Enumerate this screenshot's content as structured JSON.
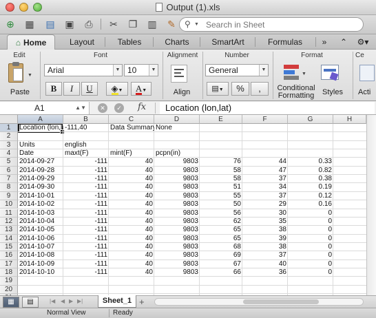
{
  "window": {
    "title": "Output (1).xls"
  },
  "toolbar": {
    "buttons": [
      {
        "icon": "new-document-icon",
        "glyph": "⊕"
      },
      {
        "icon": "templates-icon",
        "glyph": "▦"
      },
      {
        "icon": "open-icon",
        "glyph": "⎙"
      },
      {
        "icon": "save-icon",
        "glyph": "▣"
      },
      {
        "icon": "print-icon",
        "glyph": "⎙"
      },
      {
        "icon": "cut-icon",
        "glyph": "✂"
      },
      {
        "icon": "copy-icon",
        "glyph": "❐"
      },
      {
        "icon": "paste-icon",
        "glyph": "📋"
      },
      {
        "icon": "format-painter-icon",
        "glyph": "🖌"
      }
    ],
    "search_placeholder": "Search in Sheet"
  },
  "ribbon_tabs": [
    "Home",
    "Layout",
    "Tables",
    "Charts",
    "SmartArt",
    "Formulas"
  ],
  "ribbon": {
    "groups": {
      "edit": "Edit",
      "font": "Font",
      "alignment": "Alignment",
      "number": "Number",
      "format": "Format",
      "cells": "Ce"
    },
    "paste_label": "Paste",
    "font_name": "Arial",
    "font_size": "10",
    "bold": "B",
    "italic": "I",
    "underline": "U",
    "align_label": "Align",
    "number_format": "General",
    "percent": "%",
    "comma": ",",
    "conditional_label_1": "Conditional",
    "conditional_label_2": "Formatting",
    "styles_label": "Styles",
    "actions_label": "Acti"
  },
  "formula_bar": {
    "cell_ref": "A1",
    "fx": "fx",
    "content": "Location (lon,lat)"
  },
  "sheet": {
    "columns": [
      "A",
      "B",
      "C",
      "D",
      "E",
      "F",
      "G",
      "H"
    ],
    "row_numbers": [
      "1",
      "2",
      "3",
      "4",
      "5",
      "6",
      "7",
      "8",
      "9",
      "10",
      "11",
      "12",
      "13",
      "14",
      "15",
      "16",
      "17",
      "18",
      "19",
      "20",
      "21"
    ],
    "rows": [
      [
        "Location (lon,lat)",
        "-111,40",
        "Data Summary",
        "None",
        "",
        "",
        "",
        ""
      ],
      [
        "",
        "",
        "",
        "",
        "",
        "",
        "",
        ""
      ],
      [
        "Units",
        "english",
        "",
        "",
        "",
        "",
        "",
        ""
      ],
      [
        "Date",
        "maxt(F)",
        "mint(F)",
        "pcpn(in)",
        "",
        "",
        "",
        ""
      ],
      [
        "2014-09-27",
        "-111",
        "40",
        "9803",
        "76",
        "44",
        "0.33",
        ""
      ],
      [
        "2014-09-28",
        "-111",
        "40",
        "9803",
        "58",
        "47",
        "0.82",
        ""
      ],
      [
        "2014-09-29",
        "-111",
        "40",
        "9803",
        "58",
        "37",
        "0.38",
        ""
      ],
      [
        "2014-09-30",
        "-111",
        "40",
        "9803",
        "51",
        "34",
        "0.19",
        ""
      ],
      [
        "2014-10-01",
        "-111",
        "40",
        "9803",
        "55",
        "37",
        "0.12",
        ""
      ],
      [
        "2014-10-02",
        "-111",
        "40",
        "9803",
        "50",
        "29",
        "0.16",
        ""
      ],
      [
        "2014-10-03",
        "-111",
        "40",
        "9803",
        "56",
        "30",
        "0",
        ""
      ],
      [
        "2014-10-04",
        "-111",
        "40",
        "9803",
        "62",
        "35",
        "0",
        ""
      ],
      [
        "2014-10-05",
        "-111",
        "40",
        "9803",
        "65",
        "38",
        "0",
        ""
      ],
      [
        "2014-10-06",
        "-111",
        "40",
        "9803",
        "65",
        "39",
        "0",
        ""
      ],
      [
        "2014-10-07",
        "-111",
        "40",
        "9803",
        "68",
        "38",
        "0",
        ""
      ],
      [
        "2014-10-08",
        "-111",
        "40",
        "9803",
        "69",
        "37",
        "0",
        ""
      ],
      [
        "2014-10-09",
        "-111",
        "40",
        "9803",
        "67",
        "40",
        "0",
        ""
      ],
      [
        "2014-10-10",
        "-111",
        "40",
        "9803",
        "66",
        "36",
        "0",
        ""
      ],
      [
        "",
        "",
        "",
        "",
        "",
        "",
        "",
        ""
      ],
      [
        "",
        "",
        "",
        "",
        "",
        "",
        "",
        ""
      ],
      [
        "",
        "",
        "",
        "",
        "",
        "",
        "",
        ""
      ]
    ],
    "sheet_tab": "Sheet_1"
  },
  "status": {
    "view": "Normal View",
    "state": "Ready"
  },
  "colors": {
    "accent_green": "#2b7a3a",
    "selection_header": "#c9d3e0"
  }
}
